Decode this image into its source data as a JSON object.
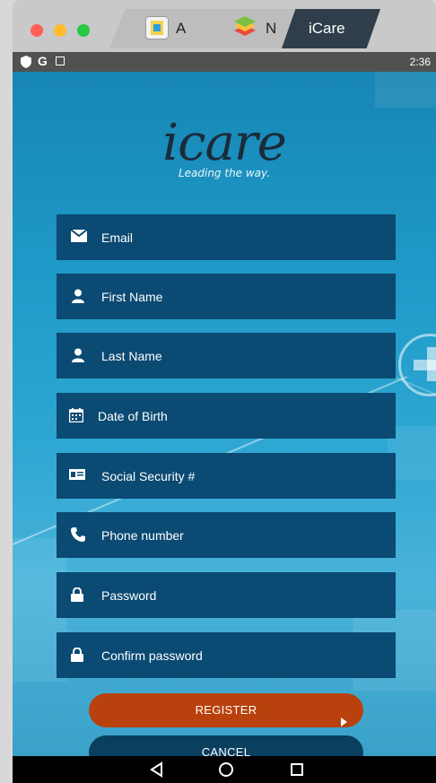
{
  "window": {
    "tabs": [
      {
        "label": "A",
        "icon": "app-store-icon"
      },
      {
        "label": "N",
        "icon": "bluestacks-icon"
      },
      {
        "label": "iCare",
        "icon": ""
      }
    ],
    "traffic_lights": {
      "close": "#ff5f57",
      "minimize": "#febc2e",
      "maximize": "#28c840"
    }
  },
  "status_bar": {
    "icons": [
      "shield-icon",
      "google-icon",
      "notification-icon"
    ],
    "time": "2:36"
  },
  "app": {
    "logo": {
      "word": "icare",
      "tagline": "Leading the way."
    },
    "fields": [
      {
        "placeholder": "Email",
        "icon": "envelope-icon"
      },
      {
        "placeholder": "First Name",
        "icon": "person-icon"
      },
      {
        "placeholder": "Last Name",
        "icon": "person-icon"
      },
      {
        "placeholder": "Date of Birth",
        "icon": "calendar-icon"
      },
      {
        "placeholder": "Social Security #",
        "icon": "id-card-icon"
      },
      {
        "placeholder": "Phone number",
        "icon": "phone-icon"
      },
      {
        "placeholder": "Password",
        "icon": "lock-icon"
      },
      {
        "placeholder": "Confirm password",
        "icon": "lock-icon"
      }
    ],
    "register_label": "REGISTER",
    "cancel_label": "CANCEL",
    "colors": {
      "field_bg": "#0a4a73",
      "register_bg": "#b8410d",
      "cancel_bg": "#0a3f5f"
    }
  },
  "nav_bar": {
    "buttons": [
      "back-icon",
      "home-icon",
      "recents-icon"
    ]
  }
}
